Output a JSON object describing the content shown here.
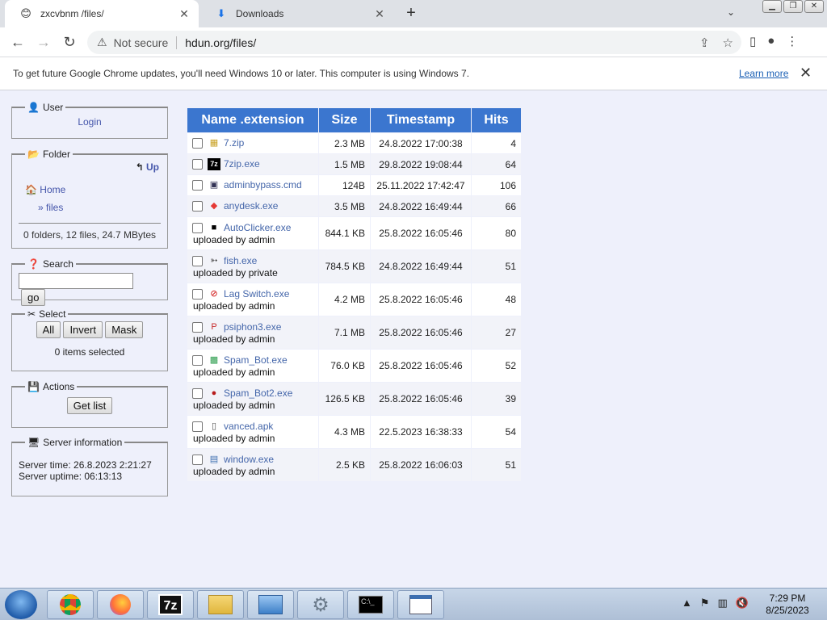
{
  "browser": {
    "tabs": [
      {
        "title": "zxcvbnm /files/",
        "favicon": "smiley-icon",
        "active": true
      },
      {
        "title": "Downloads",
        "favicon": "download-icon",
        "active": false
      }
    ],
    "new_tab": "+",
    "address": {
      "security": "Not secure",
      "url": "hdun.org/files/"
    }
  },
  "infobar": {
    "message": "To get future Google Chrome updates, you'll need Windows 10 or later. This computer is using Windows 7.",
    "learn_more": "Learn more"
  },
  "sidebar": {
    "user": {
      "legend": "User",
      "login": "Login"
    },
    "folder": {
      "legend": "Folder",
      "up": "Up",
      "home": "Home",
      "subfolder": "» files",
      "summary": "0 folders, 12 files, 24.7 MBytes"
    },
    "search": {
      "legend": "Search",
      "go": "go"
    },
    "select": {
      "legend": "Select",
      "all": "All",
      "invert": "Invert",
      "mask": "Mask",
      "status": "0 items selected"
    },
    "actions": {
      "legend": "Actions",
      "get_list": "Get list"
    },
    "server": {
      "legend": "Server information",
      "time": "Server time: 26.8.2023 2:21:27",
      "uptime": "Server uptime: 06:13:13"
    }
  },
  "table": {
    "headers": [
      "Name .extension",
      "Size",
      "Timestamp",
      "Hits"
    ],
    "rows": [
      {
        "name": "7.zip",
        "icon": "zip-icon",
        "uploader": "",
        "size": "2.3 MB",
        "timestamp": "24.8.2022 17:00:38",
        "hits": "4"
      },
      {
        "name": "7zip.exe",
        "icon": "7zip-icon",
        "uploader": "",
        "size": "1.5 MB",
        "timestamp": "29.8.2022 19:08:44",
        "hits": "64"
      },
      {
        "name": "adminbypass.cmd",
        "icon": "cmd-icon",
        "uploader": "",
        "size": "124B",
        "timestamp": "25.11.2022 17:42:47",
        "hits": "106"
      },
      {
        "name": "anydesk.exe",
        "icon": "anydesk-icon",
        "uploader": "",
        "size": "3.5 MB",
        "timestamp": "24.8.2022 16:49:44",
        "hits": "66"
      },
      {
        "name": "AutoClicker.exe",
        "icon": "autoclicker-icon",
        "uploader": "uploaded by admin",
        "size": "844.1 KB",
        "timestamp": "25.8.2022 16:05:46",
        "hits": "80"
      },
      {
        "name": "fish.exe",
        "icon": "fish-icon",
        "uploader": "uploaded by private",
        "size": "784.5 KB",
        "timestamp": "24.8.2022 16:49:44",
        "hits": "51"
      },
      {
        "name": "Lag Switch.exe",
        "icon": "no-sign-icon",
        "uploader": "uploaded by admin",
        "size": "4.2 MB",
        "timestamp": "25.8.2022 16:05:46",
        "hits": "48"
      },
      {
        "name": "psiphon3.exe",
        "icon": "psiphon-icon",
        "uploader": "uploaded by admin",
        "size": "7.1 MB",
        "timestamp": "25.8.2022 16:05:46",
        "hits": "27"
      },
      {
        "name": "Spam_Bot.exe",
        "icon": "green-app-icon",
        "uploader": "uploaded by admin",
        "size": "76.0 KB",
        "timestamp": "25.8.2022 16:05:46",
        "hits": "52"
      },
      {
        "name": "Spam_Bot2.exe",
        "icon": "red-circle-icon",
        "uploader": "uploaded by admin",
        "size": "126.5 KB",
        "timestamp": "25.8.2022 16:05:46",
        "hits": "39"
      },
      {
        "name": "vanced.apk",
        "icon": "file-icon",
        "uploader": "uploaded by admin",
        "size": "4.3 MB",
        "timestamp": "22.5.2023 16:38:33",
        "hits": "54"
      },
      {
        "name": "window.exe",
        "icon": "window-icon",
        "uploader": "uploaded by admin",
        "size": "2.5 KB",
        "timestamp": "25.8.2022 16:06:03",
        "hits": "51"
      }
    ]
  },
  "taskbar": {
    "clock_time": "7:29 PM",
    "clock_date": "8/25/2023",
    "items": [
      "chrome-icon",
      "firefox-icon",
      "7zip-icon",
      "folder-icon",
      "control-panel-icon",
      "settings-gear-icon",
      "terminal-icon",
      "window-app-icon"
    ]
  }
}
